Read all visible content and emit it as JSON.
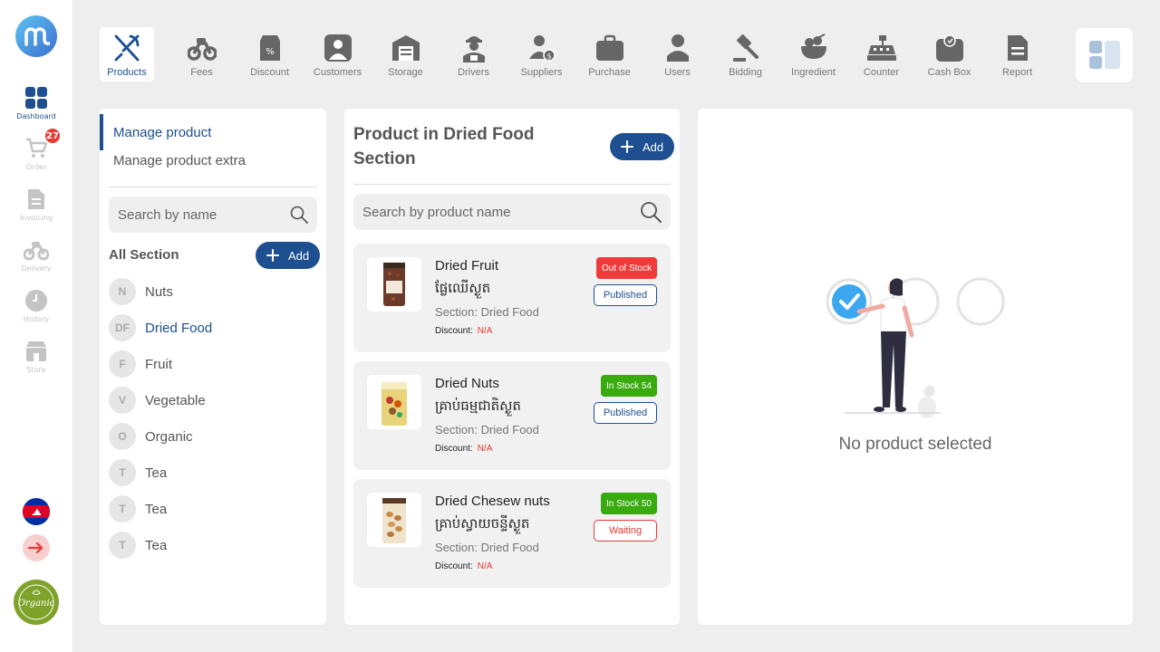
{
  "rail": {
    "items": [
      {
        "label": "Dashboard",
        "icon": "dashboard-icon"
      },
      {
        "label": "Order",
        "icon": "cart-icon",
        "badge": "27"
      },
      {
        "label": "Invoicing",
        "icon": "invoice-icon"
      },
      {
        "label": "Delivery",
        "icon": "scooter-icon"
      },
      {
        "label": "History",
        "icon": "clock-icon"
      },
      {
        "label": "Store",
        "icon": "store-icon"
      }
    ],
    "store_logo_text": "Organic"
  },
  "toolbar": {
    "items": [
      {
        "label": "Products",
        "icon": "fork-knife-icon"
      },
      {
        "label": "Fees",
        "icon": "scooter-icon"
      },
      {
        "label": "Discount",
        "icon": "discount-icon"
      },
      {
        "label": "Customers",
        "icon": "customer-icon"
      },
      {
        "label": "Storage",
        "icon": "warehouse-icon"
      },
      {
        "label": "Drivers",
        "icon": "driver-icon"
      },
      {
        "label": "Suppliers",
        "icon": "supplier-icon"
      },
      {
        "label": "Purchase",
        "icon": "bag-icon"
      },
      {
        "label": "Users",
        "icon": "user-icon"
      },
      {
        "label": "Bidding",
        "icon": "gavel-icon"
      },
      {
        "label": "Ingredient",
        "icon": "bowl-icon"
      },
      {
        "label": "Counter",
        "icon": "register-icon"
      },
      {
        "label": "Cash Box",
        "icon": "cashbox-icon"
      },
      {
        "label": "Report",
        "icon": "report-icon"
      }
    ]
  },
  "sections_panel": {
    "menu": [
      "Manage product",
      "Manage product extra"
    ],
    "search_placeholder": "Search by name",
    "title": "All Section",
    "add_label": "Add",
    "sections": [
      {
        "initials": "N",
        "name": "Nuts"
      },
      {
        "initials": "DF",
        "name": "Dried Food"
      },
      {
        "initials": "F",
        "name": "Fruit"
      },
      {
        "initials": "V",
        "name": "Vegetable"
      },
      {
        "initials": "O",
        "name": "Organic"
      },
      {
        "initials": "T",
        "name": "Tea"
      },
      {
        "initials": "T",
        "name": "Tea"
      },
      {
        "initials": "T",
        "name": "Tea"
      }
    ]
  },
  "products_panel": {
    "title": "Product in Dried Food Section",
    "add_label": "Add",
    "search_placeholder": "Search by product name",
    "discount_label": "Discount:",
    "products": [
      {
        "name": "Dried Fruit",
        "name_kh": "ផ្លែឈើស្ងួត",
        "section": "Section: Dried Food",
        "discount": "N/A",
        "stock": "Out of Stock",
        "status": "Published"
      },
      {
        "name": "Dried Nuts",
        "name_kh": "គ្រាប់ធម្មជាតិស្ងួត",
        "section": "Section: Dried Food",
        "discount": "N/A",
        "stock": "In Stock  54",
        "status": "Published"
      },
      {
        "name": "Dried Chesew nuts",
        "name_kh": "គ្រាប់ស្វាយចន្ទីស្ងួត",
        "section": "Section: Dried Food",
        "discount": "N/A",
        "stock": "In Stock  50",
        "status": "Waiting"
      }
    ]
  },
  "detail_panel": {
    "empty_text": "No product selected"
  },
  "colors": {
    "accent": "#1d4f91",
    "out_of_stock": "#f03a3a",
    "in_stock": "#3aab0f",
    "waiting": "#e53935"
  }
}
